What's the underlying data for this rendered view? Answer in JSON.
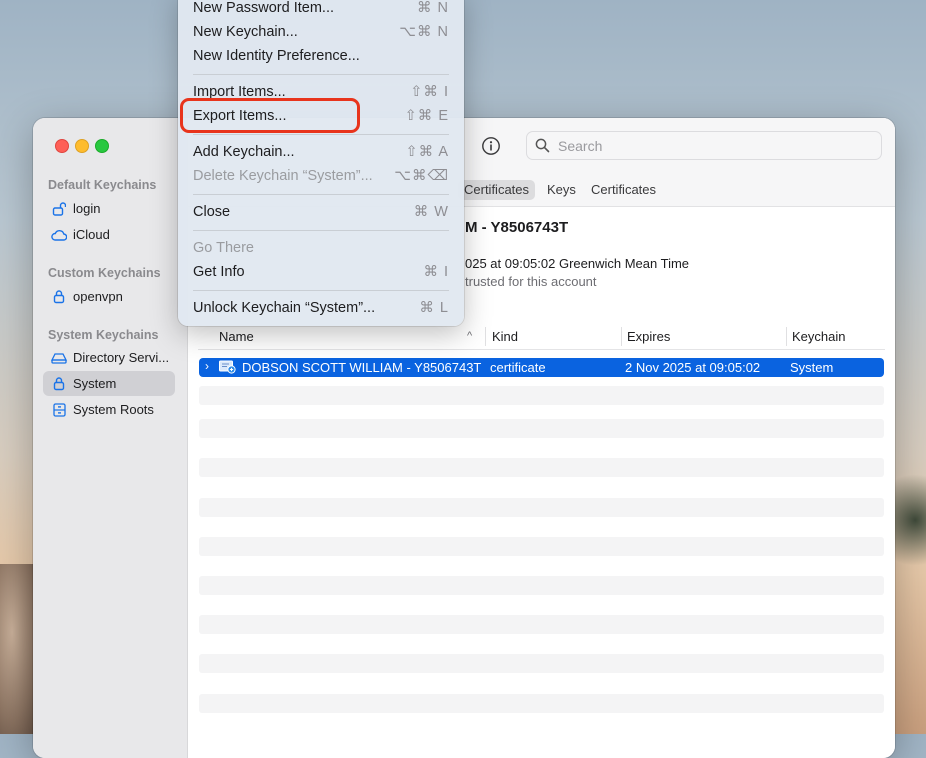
{
  "menu": {
    "items": [
      {
        "label": "New Password Item...",
        "shortcut": "⌘ N"
      },
      {
        "label": "New Keychain...",
        "shortcut": "⌥⌘ N"
      },
      {
        "label": "New Identity Preference...",
        "shortcut": ""
      },
      {
        "label": "Import Items...",
        "shortcut": "⇧⌘ I"
      },
      {
        "label": "Export Items...",
        "shortcut": "⇧⌘ E"
      },
      {
        "label": "Add Keychain...",
        "shortcut": "⇧⌘ A"
      },
      {
        "label": "Delete Keychain “System”...",
        "shortcut": "⌥⌘⌫"
      },
      {
        "label": "Close",
        "shortcut": "⌘ W"
      },
      {
        "label": "Go There",
        "shortcut": ""
      },
      {
        "label": "Get Info",
        "shortcut": "⌘ I"
      },
      {
        "label": "Unlock Keychain “System”...",
        "shortcut": "⌘ L"
      }
    ],
    "highlight_color": "#e8341c"
  },
  "sidebar": {
    "groups": [
      {
        "header": "Default Keychains",
        "items": [
          {
            "label": "login",
            "icon": "unlock-icon"
          },
          {
            "label": "iCloud",
            "icon": "cloud-icon"
          }
        ]
      },
      {
        "header": "Custom Keychains",
        "items": [
          {
            "label": "openvpn",
            "icon": "lock-icon"
          }
        ]
      },
      {
        "header": "System Keychains",
        "items": [
          {
            "label": "Directory Servi...",
            "icon": "network-icon"
          },
          {
            "label": "System",
            "icon": "lock-icon",
            "selected": true
          },
          {
            "label": "System Roots",
            "icon": "cabinet-icon"
          }
        ]
      }
    ]
  },
  "search": {
    "placeholder": "Search"
  },
  "tabs": [
    "Certificates",
    "Keys",
    "Certificates"
  ],
  "detail": {
    "title": "M - Y8506743T",
    "expires": "025 at 09:05:02 Greenwich Mean Time",
    "trust": "trusted for this account"
  },
  "table": {
    "columns": [
      "Name",
      "Kind",
      "Expires",
      "Keychain"
    ],
    "rows": [
      {
        "name": "DOBSON SCOTT WILLIAM - Y8506743T",
        "kind": "certificate",
        "expires": "2 Nov 2025 at 09:05:02",
        "keychain": "System",
        "selected": true
      }
    ]
  },
  "colors": {
    "selection": "#0a63e0",
    "accent_red": "#e8341c"
  }
}
